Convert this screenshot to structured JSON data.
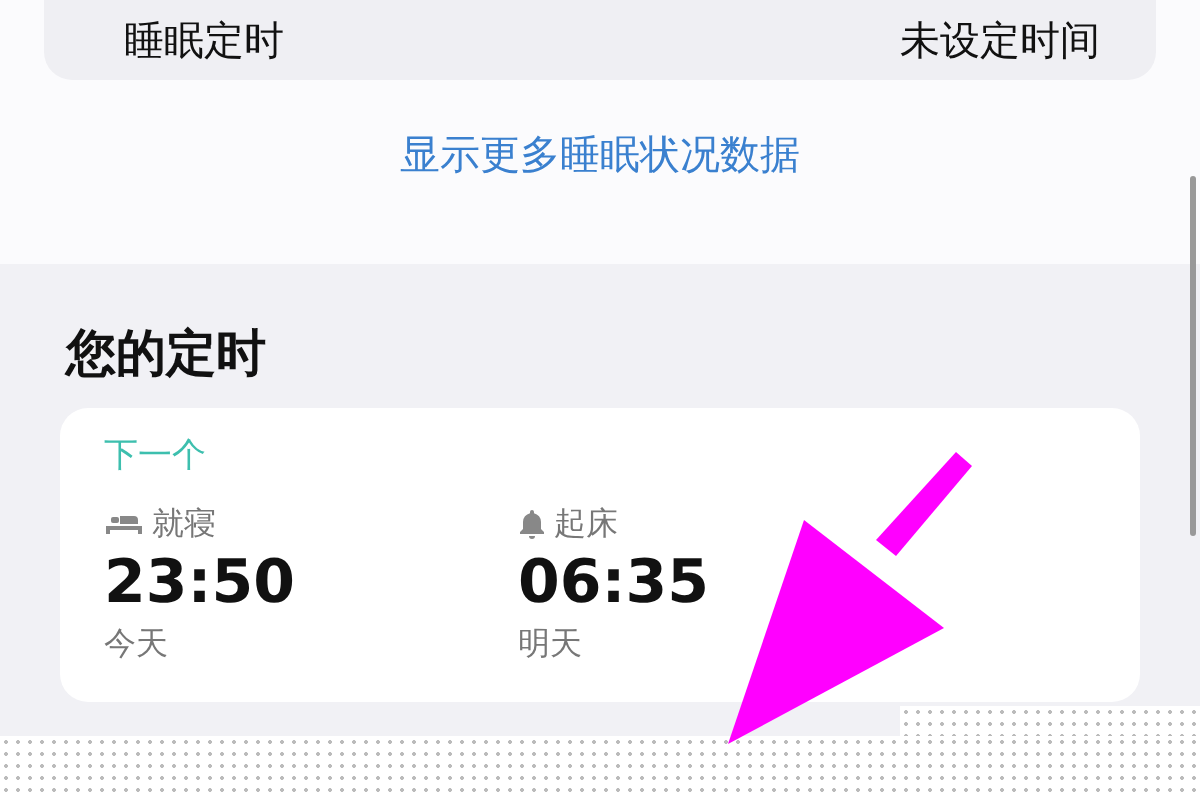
{
  "top_row": {
    "label": "睡眠定时",
    "value": "未设定时间"
  },
  "more_link": "显示更多睡眠状况数据",
  "section_title": "您的定时",
  "schedule_card": {
    "heading": "下一个",
    "items": [
      {
        "kind": "bedtime",
        "label": "就寝",
        "time": "23:50",
        "day": "今天"
      },
      {
        "kind": "wake",
        "label": "起床",
        "time": "06:35",
        "day": "明天"
      }
    ]
  }
}
